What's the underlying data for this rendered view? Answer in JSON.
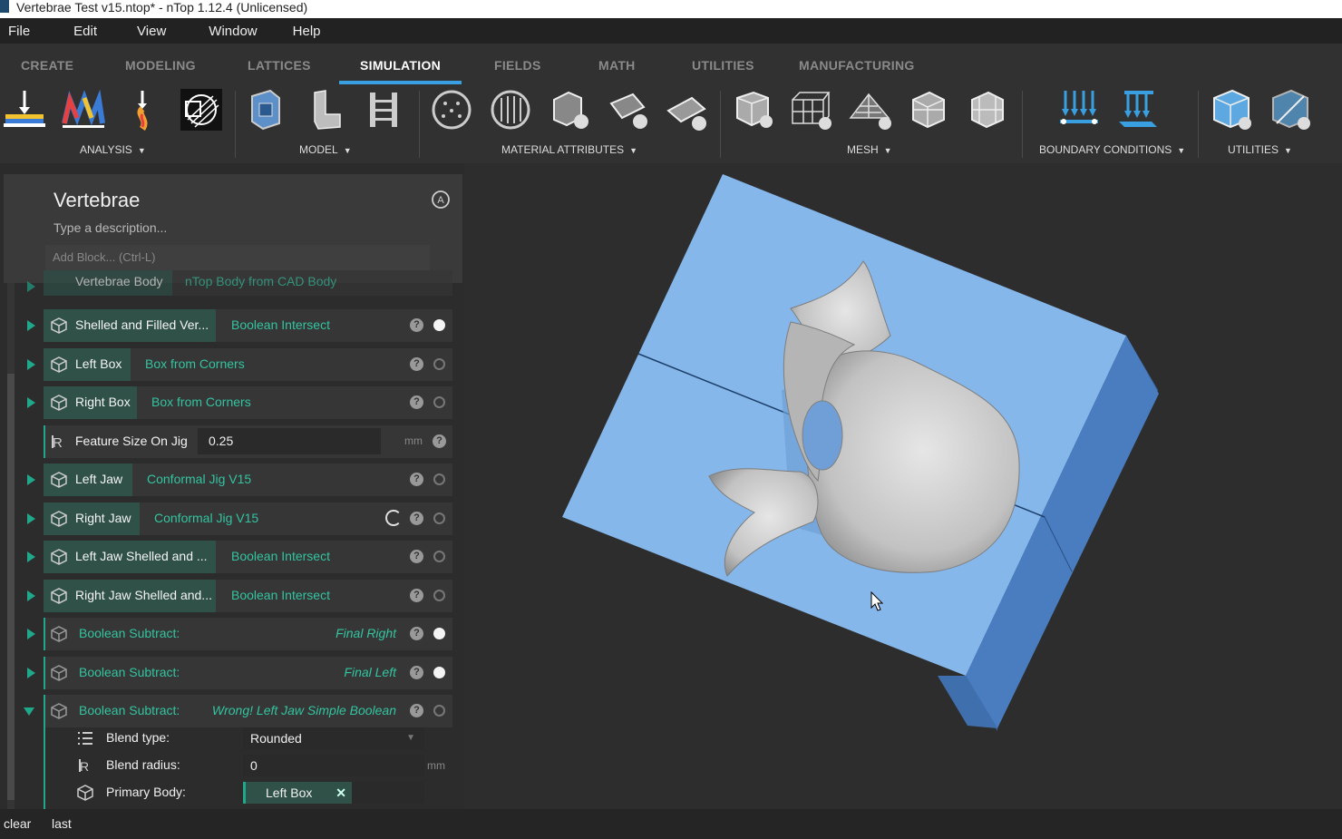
{
  "window": {
    "title": "Vertebrae Test v15.ntop* - nTop 1.12.4 (Unlicensed)"
  },
  "menu": [
    "File",
    "Edit",
    "View",
    "Window",
    "Help"
  ],
  "tabs": [
    "CREATE",
    "MODELING",
    "LATTICES",
    "SIMULATION",
    "FIELDS",
    "MATH",
    "UTILITIES",
    "MANUFACTURING"
  ],
  "active_tab": "SIMULATION",
  "ribbon_groups": {
    "analysis": "ANALYSIS",
    "model": "MODEL",
    "material": "MATERIAL ATTRIBUTES",
    "mesh": "MESH",
    "boundary": "BOUNDARY CONDITIONS",
    "utilities": "UTILITIES"
  },
  "notebook": {
    "title": "Vertebrae",
    "description_placeholder": "Type a description...",
    "add_block_placeholder": "Add Block... (Ctrl-L)"
  },
  "blocks": [
    {
      "name": "Vertebrae Body",
      "type": "nTop Body from CAD Body"
    },
    {
      "name": "Shelled and Filled Ver...",
      "type": "Boolean Intersect",
      "state": "filled"
    },
    {
      "name": "Left Box",
      "type": "Box from Corners",
      "state": "empty"
    },
    {
      "name": "Right Box",
      "type": "Box from Corners",
      "state": "empty"
    },
    {
      "name": "Feature Size On Jig",
      "value": "0.25",
      "unit": "mm"
    },
    {
      "name": "Left Jaw",
      "type": "Conformal Jig V15",
      "state": "empty"
    },
    {
      "name": "Right Jaw",
      "type": "Conformal Jig V15",
      "state": "empty"
    },
    {
      "name": "Left Jaw Shelled and ...",
      "type": "Boolean Intersect",
      "state": "empty"
    },
    {
      "name": "Right Jaw Shelled and...",
      "type": "Boolean Intersect",
      "state": "empty"
    },
    {
      "name": "Boolean Subtract:",
      "output": "Final Right",
      "state": "filled"
    },
    {
      "name": "Boolean Subtract:",
      "output": "Final Left",
      "state": "filled"
    },
    {
      "name": "Boolean Subtract:",
      "output": "Wrong! Left Jaw Simple Boolean",
      "state": "empty"
    }
  ],
  "expanded_inputs": {
    "blend_type_label": "Blend type:",
    "blend_type_value": "Rounded",
    "blend_radius_label": "Blend radius:",
    "blend_radius_value": "0",
    "blend_radius_unit": "mm",
    "primary_body_label": "Primary Body:",
    "primary_body_value": "Left Box",
    "primary_body_remove": "✕"
  },
  "help_glyph": "?",
  "status": {
    "left": "clear",
    "right": "last"
  },
  "colors": {
    "accent": "#3a9fe0",
    "teal": "#33c4a0",
    "jig_blue": "#86b7ea",
    "bone": "#c9c9c9"
  }
}
